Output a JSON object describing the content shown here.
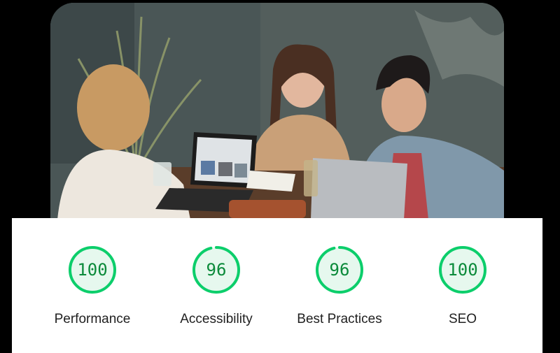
{
  "hero": {
    "icon": "team-meeting-photo"
  },
  "scores": [
    {
      "label": "Performance",
      "value": 100,
      "percent": 100
    },
    {
      "label": "Accessibility",
      "value": 96,
      "percent": 96
    },
    {
      "label": "Best Practices",
      "value": 96,
      "percent": 96
    },
    {
      "label": "SEO",
      "value": 100,
      "percent": 100
    }
  ],
  "colors": {
    "pass": "#0cce6b",
    "pass_text": "#0b8a3a",
    "pass_fill": "#e6f8ee"
  }
}
